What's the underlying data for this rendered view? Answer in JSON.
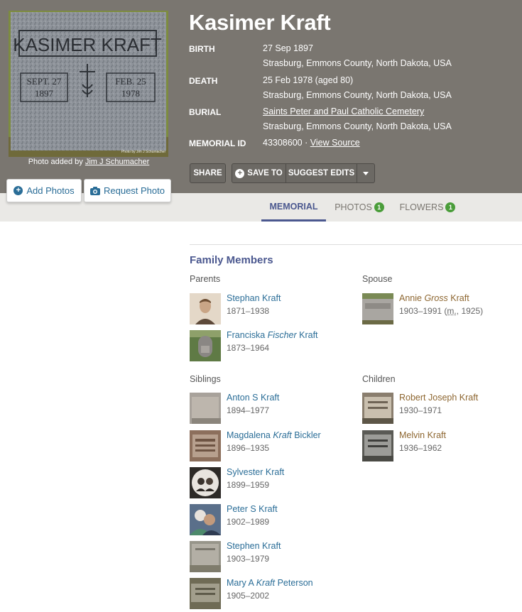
{
  "memorial": {
    "name": "Kasimer Kraft",
    "photo_credit_prefix": "Photo added by",
    "photo_credit_user": "Jim J Schumacher",
    "headstone_text": {
      "name": "KASIMER KRAFT",
      "left_date_line1": "SEPT. 27",
      "left_date_line2": "1897",
      "right_date_line1": "FEB. 25",
      "right_date_line2": "1978",
      "watermark": "Photo by Jim J Schumacher"
    },
    "birth_label": "BIRTH",
    "birth_date": "27 Sep 1897",
    "birth_place": "Strasburg, Emmons County, North Dakota, USA",
    "death_label": "DEATH",
    "death_date": "25 Feb 1978 (aged 80)",
    "death_place": "Strasburg, Emmons County, North Dakota, USA",
    "burial_label": "BURIAL",
    "burial_cemetery": "Saints Peter and Paul Catholic Cemetery",
    "burial_place": "Strasburg, Emmons County, North Dakota, USA",
    "memorial_id_label": "MEMORIAL ID",
    "memorial_id": "43308600",
    "view_source": "View Source"
  },
  "photo_buttons": {
    "add_photos": "Add Photos",
    "request_photo": "Request Photo"
  },
  "actions": {
    "share": "SHARE",
    "save_to": "SAVE TO",
    "suggest_edits": "SUGGEST EDITS"
  },
  "tabs": [
    {
      "label": "MEMORIAL"
    },
    {
      "label": "PHOTOS",
      "count": "1"
    },
    {
      "label": "FLOWERS",
      "count": "1"
    }
  ],
  "family": {
    "title": "Family Members",
    "parents_label": "Parents",
    "spouse_label": "Spouse",
    "siblings_label": "Siblings",
    "children_label": "Children",
    "parents": [
      {
        "name": "Stephan Kraft",
        "dates": "1871–1938"
      },
      {
        "first": "Franciska ",
        "maiden": "Fischer",
        "last": " Kraft",
        "dates": "1873–1964"
      }
    ],
    "spouse": {
      "first": "Annie ",
      "maiden": "Gross",
      "last": " Kraft",
      "dates": "1903–1991",
      "marriage_prefix": "m.",
      "marriage_year": "1925"
    },
    "siblings": [
      {
        "name": "Anton S Kraft",
        "dates": "1894–1977"
      },
      {
        "first": "Magdalena ",
        "maiden": "Kraft",
        "last": " Bickler",
        "dates": "1896–1935"
      },
      {
        "name": "Sylvester Kraft",
        "dates": "1899–1959"
      },
      {
        "name": "Peter S Kraft",
        "dates": "1902–1989"
      },
      {
        "name": "Stephen Kraft",
        "dates": "1903–1979"
      },
      {
        "first": "Mary A ",
        "maiden": "Kraft",
        "last": " Peterson",
        "dates": "1905–2002"
      }
    ],
    "children": [
      {
        "name": "Robert Joseph Kraft",
        "dates": "1930–1971"
      },
      {
        "name": "Melvin Kraft",
        "dates": "1936–1962"
      }
    ]
  },
  "colors": {
    "header_bg": "#7a7670",
    "tab_bg": "#eae9e6",
    "accent": "#4b588f",
    "link_blue": "#2a6d97",
    "link_brown": "#8d6630",
    "badge_green": "#4a9d3a"
  }
}
